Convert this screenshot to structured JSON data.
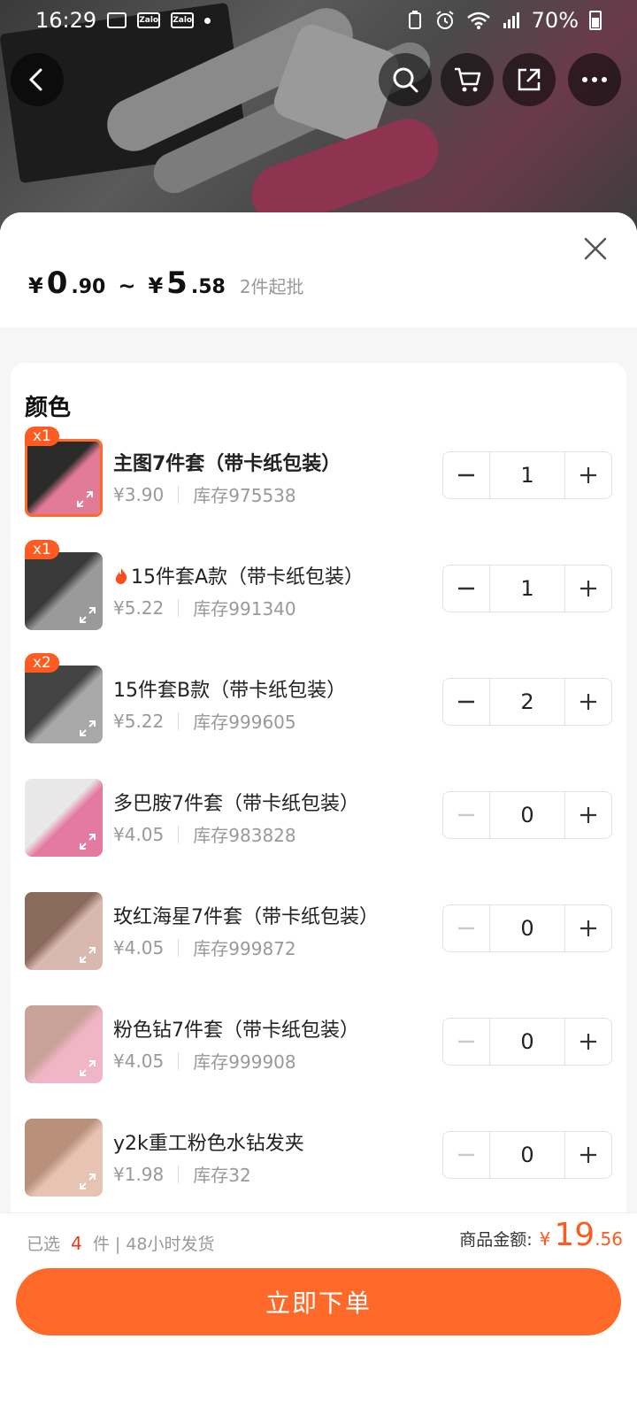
{
  "status_bar": {
    "time": "16:29",
    "icons": [
      "image-icon",
      "zalo-icon",
      "zalo-icon",
      "dot-icon"
    ],
    "zalo_label": "Zalo",
    "battery": "70%"
  },
  "header": {
    "buttons": [
      "back",
      "search",
      "cart",
      "share",
      "more"
    ]
  },
  "price": {
    "min_symbol": "¥",
    "min_int": "0",
    "min_dec": ".90",
    "separator": "~",
    "max_symbol": "¥",
    "max_int": "5",
    "max_dec": ".58",
    "min_order": "2件起批"
  },
  "section_title": "颜色",
  "items": [
    {
      "name": "主图7件套（带卡纸包装）",
      "price": "¥3.90",
      "stock": "库存975538",
      "qty": "1",
      "badge": "x1",
      "selected": true,
      "fire": false,
      "colors": [
        "#2a2a2a",
        "#e07a96"
      ]
    },
    {
      "name": "15件套A款（带卡纸包装）",
      "price": "¥5.22",
      "stock": "库存991340",
      "qty": "1",
      "badge": "x1",
      "selected": false,
      "fire": true,
      "colors": [
        "#3a3a3a",
        "#9a9a9a"
      ]
    },
    {
      "name": "15件套B款（带卡纸包装）",
      "price": "¥5.22",
      "stock": "库存999605",
      "qty": "2",
      "badge": "x2",
      "selected": false,
      "fire": false,
      "colors": [
        "#444",
        "#a8a8a8"
      ]
    },
    {
      "name": "多巴胺7件套（带卡纸包装）",
      "price": "¥4.05",
      "stock": "库存983828",
      "qty": "0",
      "badge": "",
      "selected": false,
      "fire": false,
      "colors": [
        "#e8e8e8",
        "#e57aa0"
      ]
    },
    {
      "name": "玫红海星7件套（带卡纸包装）",
      "price": "¥4.05",
      "stock": "库存999872",
      "qty": "0",
      "badge": "",
      "selected": false,
      "fire": false,
      "colors": [
        "#8a6a5a",
        "#d9b8b0"
      ]
    },
    {
      "name": "粉色钻7件套（带卡纸包装）",
      "price": "¥4.05",
      "stock": "库存999908",
      "qty": "0",
      "badge": "",
      "selected": false,
      "fire": false,
      "colors": [
        "#c9a39a",
        "#f0b6c8"
      ]
    },
    {
      "name": "y2k重工粉色水钻发夹",
      "price": "¥1.98",
      "stock": "库存32",
      "qty": "0",
      "badge": "",
      "selected": false,
      "fire": false,
      "colors": [
        "#b9907a",
        "#e6c3b3"
      ]
    }
  ],
  "footer": {
    "selected_prefix": "已选",
    "selected_count": "4",
    "selected_suffix": "件 | 48小时发货",
    "total_label": "商品金额:",
    "total_yen": "¥",
    "total_int": "19",
    "total_dec": ".56",
    "order_button": "立即下单"
  },
  "colors": {
    "accent": "#ff6a2a",
    "badge": "#ff5a1f",
    "count_red": "#e53b1a"
  }
}
